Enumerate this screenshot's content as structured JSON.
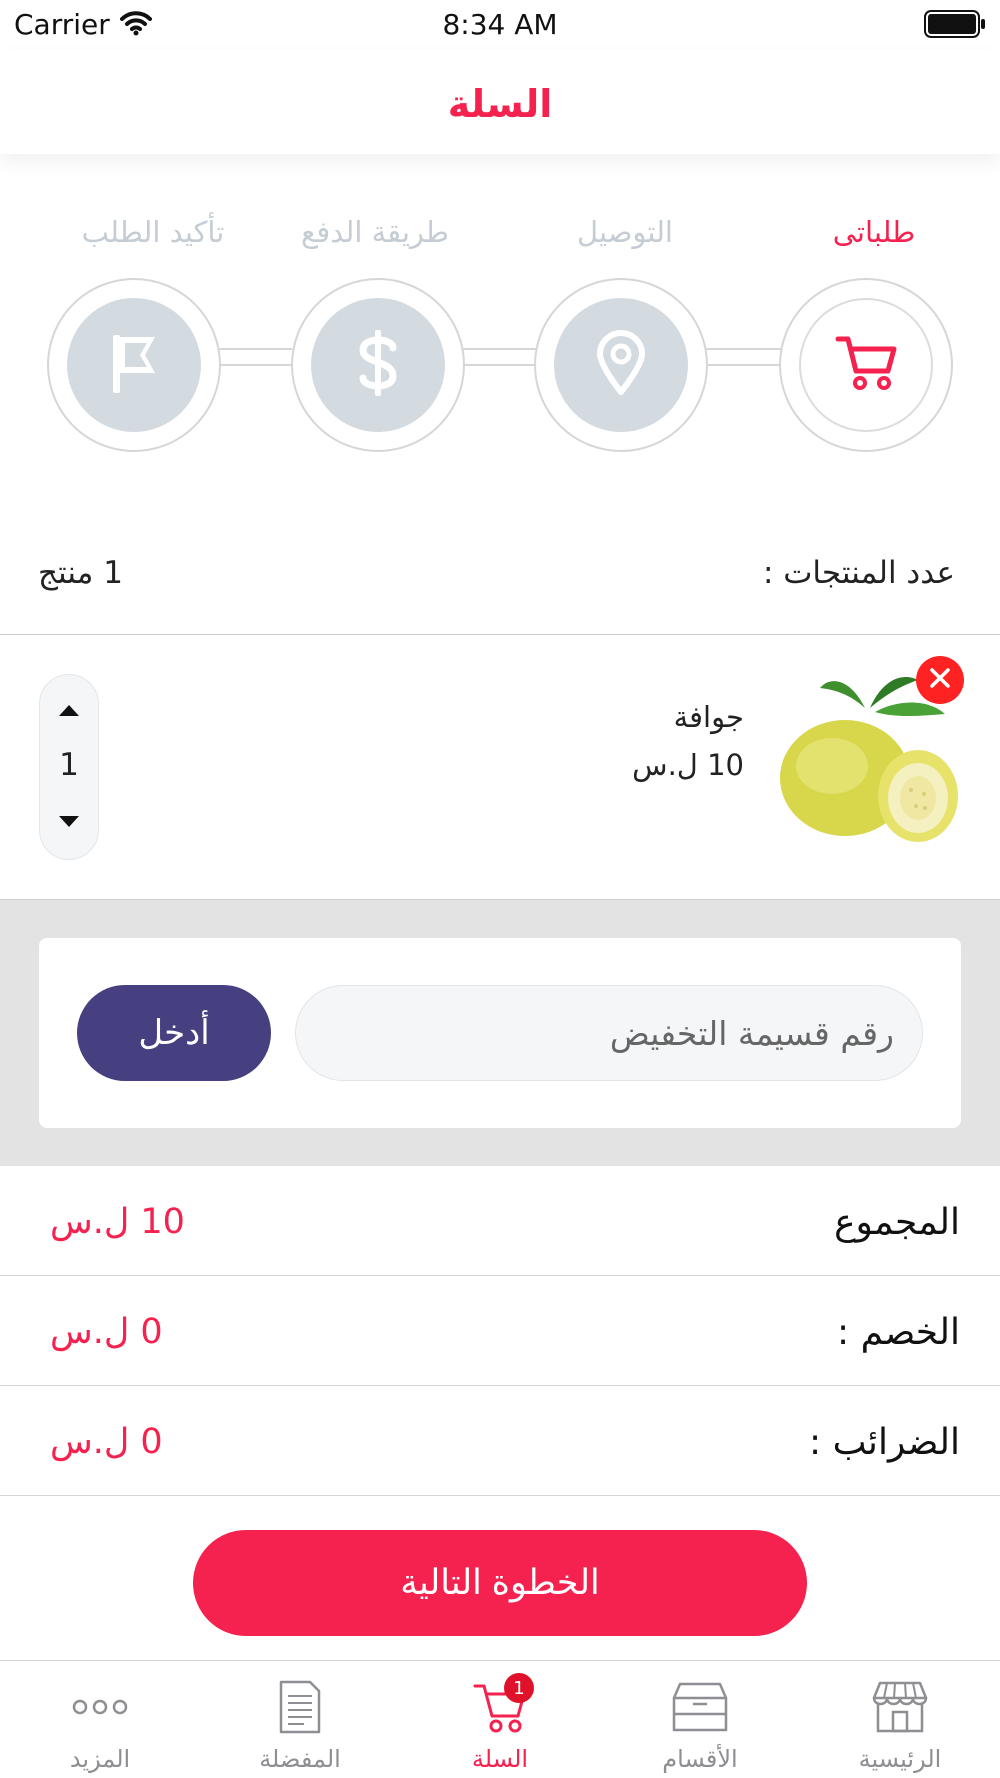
{
  "status_bar": {
    "carrier": "Carrier",
    "time": "8:34 AM"
  },
  "header": {
    "title": "السلة"
  },
  "steps": [
    {
      "label": "طلباتى",
      "icon": "cart-icon",
      "active": true
    },
    {
      "label": "التوصيل",
      "icon": "location-pin-icon",
      "active": false
    },
    {
      "label": "طريقة الدفع",
      "icon": "dollar-icon",
      "active": false
    },
    {
      "label": "تأكيد الطلب",
      "icon": "flag-icon",
      "active": false
    }
  ],
  "cart_summary": {
    "count_label": "عدد المنتجات :",
    "count_value": "1 منتج"
  },
  "product": {
    "name": "جوافة",
    "price": "10 ل.س",
    "quantity": "1",
    "image": "guava-image"
  },
  "coupon": {
    "placeholder": "رقم قسيمة التخفيض",
    "apply_label": "أدخل"
  },
  "totals": [
    {
      "label": "المجموع",
      "value": "10 ل.س"
    },
    {
      "label": "الخصم :",
      "value": "0 ل.س"
    },
    {
      "label": "الضرائب :",
      "value": "0 ل.س"
    }
  ],
  "next_button": {
    "label": "الخطوة التالية"
  },
  "tab_bar": {
    "items": [
      {
        "label": "الرئيسية",
        "icon": "store-icon"
      },
      {
        "label": "الأقسام",
        "icon": "box-icon"
      },
      {
        "label": "السلة",
        "icon": "cart-icon",
        "badge": "1",
        "active": true
      },
      {
        "label": "المفضلة",
        "icon": "document-icon"
      },
      {
        "label": "المزيد",
        "icon": "more-dots-icon"
      }
    ]
  },
  "colors": {
    "accent": "#f5214e",
    "secondary": "#463f80",
    "inactive_step": "#d3dae0"
  }
}
